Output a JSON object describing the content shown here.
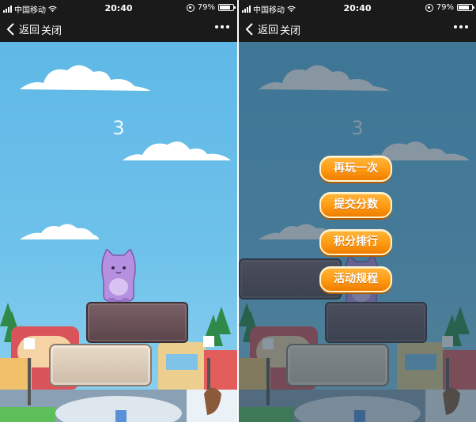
{
  "screens": [
    {
      "status": {
        "carrier": "中国移动",
        "time": "20:40",
        "battery": "79%",
        "battery_fraction": 0.79
      },
      "nav": {
        "back_label": "返回",
        "close_label": "关闭"
      },
      "game": {
        "score": "3"
      }
    },
    {
      "status": {
        "carrier": "中国移动",
        "time": "20:40",
        "battery": "79%",
        "battery_fraction": 0.79
      },
      "nav": {
        "back_label": "返回",
        "close_label": "关闭"
      },
      "game": {
        "score": "3"
      },
      "menu": {
        "items": [
          {
            "label": "再玩一次"
          },
          {
            "label": "提交分数"
          },
          {
            "label": "积分排行"
          },
          {
            "label": "活动规程"
          }
        ]
      }
    }
  ],
  "colors": {
    "bar": "#1a1a1a",
    "sky": "#5fb8e6",
    "button_orange": "#ff9a12",
    "cat_purple": "#b58fe0"
  },
  "icons": [
    "signal-icon",
    "wifi-icon",
    "orientation-lock-icon",
    "battery-icon",
    "chevron-left-icon",
    "more-dots-icon"
  ]
}
